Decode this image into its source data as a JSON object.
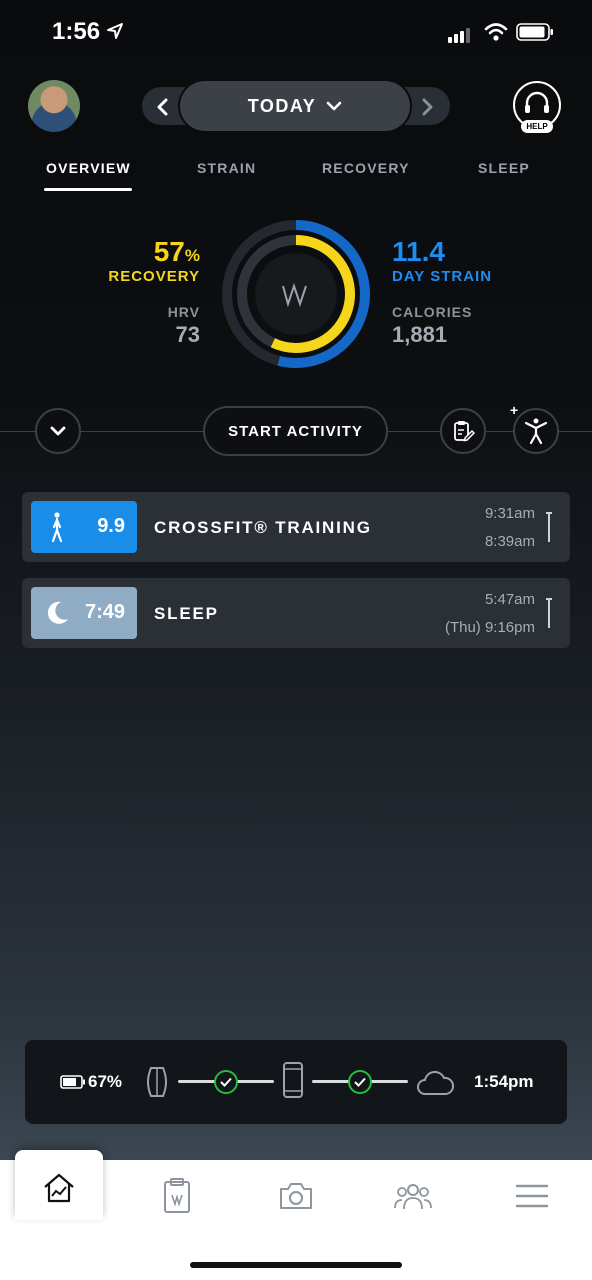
{
  "status_bar": {
    "time": "1:56"
  },
  "header": {
    "date_label": "TODAY",
    "help_label": "HELP",
    "icons": {
      "avatar": "user-avatar",
      "prev": "chevron-left-icon",
      "next": "chevron-right-icon",
      "dropdown": "chevron-down-icon",
      "help": "headset-icon"
    }
  },
  "tabs": [
    {
      "label": "OVERVIEW",
      "active": true
    },
    {
      "label": "STRAIN",
      "active": false
    },
    {
      "label": "RECOVERY",
      "active": false
    },
    {
      "label": "SLEEP",
      "active": false
    }
  ],
  "metrics": {
    "recovery_value": "57",
    "recovery_unit": "%",
    "recovery_label": "RECOVERY",
    "recovery_fraction": 0.57,
    "hrv_label": "HRV",
    "hrv_value": "73",
    "strain_value": "11.4",
    "strain_label": "DAY STRAIN",
    "strain_fraction": 0.54,
    "calories_label": "CALORIES",
    "calories_value": "1,881",
    "colors": {
      "recovery": "#f6d61a",
      "strain": "#1f8cf0"
    }
  },
  "actions": {
    "start_activity_label": "START ACTIVITY",
    "plus_label": "+",
    "icons": {
      "expand": "chevron-down-icon",
      "journal": "clipboard-edit-icon",
      "add_activity": "person-icon"
    }
  },
  "activities": [
    {
      "type": "crossfit",
      "value": "9.9",
      "title": "CROSSFIT® TRAINING",
      "end_time": "9:31am",
      "start_time": "8:39am",
      "color": "#1a8de8",
      "icon": "person-standing-icon"
    },
    {
      "type": "sleep",
      "value": "7:49",
      "title": "SLEEP",
      "end_time": "5:47am",
      "start_time": "(Thu) 9:16pm",
      "color": "#8facc4",
      "icon": "moon-icon"
    }
  ],
  "sync": {
    "battery": "67%",
    "last_sync": "1:54pm",
    "icons": [
      "battery-icon",
      "strap-icon",
      "check-icon",
      "phone-icon",
      "check-icon",
      "cloud-icon"
    ]
  },
  "bottom_nav": {
    "items": [
      {
        "name": "home",
        "icon": "home-chart-icon",
        "active": true
      },
      {
        "name": "journal",
        "icon": "clipboard-icon",
        "active": false
      },
      {
        "name": "camera",
        "icon": "camera-icon",
        "active": false
      },
      {
        "name": "teams",
        "icon": "group-icon",
        "active": false
      },
      {
        "name": "menu",
        "icon": "menu-icon",
        "active": false
      }
    ]
  }
}
